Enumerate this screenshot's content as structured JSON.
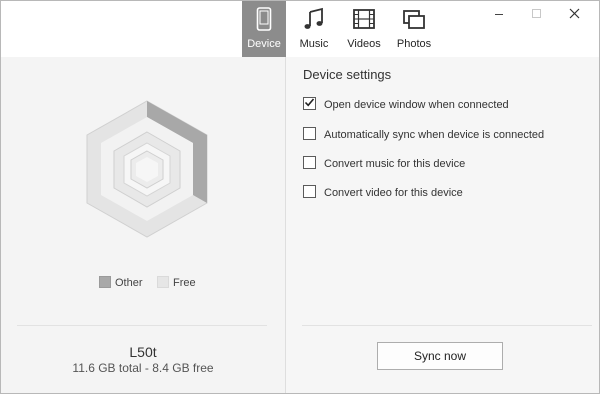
{
  "tabs": [
    {
      "label": "Device",
      "icon": "phone-icon",
      "active": true
    },
    {
      "label": "Music",
      "icon": "music-note-icon",
      "active": false
    },
    {
      "label": "Videos",
      "icon": "film-strip-icon",
      "active": false
    },
    {
      "label": "Photos",
      "icon": "photos-icon",
      "active": false
    }
  ],
  "window_controls": [
    "minimize-icon",
    "maximize-icon",
    "close-icon"
  ],
  "storage": {
    "legend": [
      {
        "label": "Other",
        "color": "#a8a8a8"
      },
      {
        "label": "Free",
        "color": "#e6e6e6"
      }
    ],
    "used_fraction": 0.28
  },
  "device": {
    "name": "L50t",
    "info": "11.6 GB total - 8.4 GB free"
  },
  "settings": {
    "title": "Device settings",
    "options": [
      {
        "label": "Open device window when connected",
        "checked": true
      },
      {
        "label": "Automatically sync when device is connected",
        "checked": false
      },
      {
        "label": "Convert music for this device",
        "checked": false
      },
      {
        "label": "Convert video for this device",
        "checked": false
      }
    ]
  },
  "sync_button": "Sync now",
  "colors": {
    "active_tab": "#8c8c8c",
    "other_segment": "#a8a8a8",
    "free_segment": "#e6e6e6"
  }
}
